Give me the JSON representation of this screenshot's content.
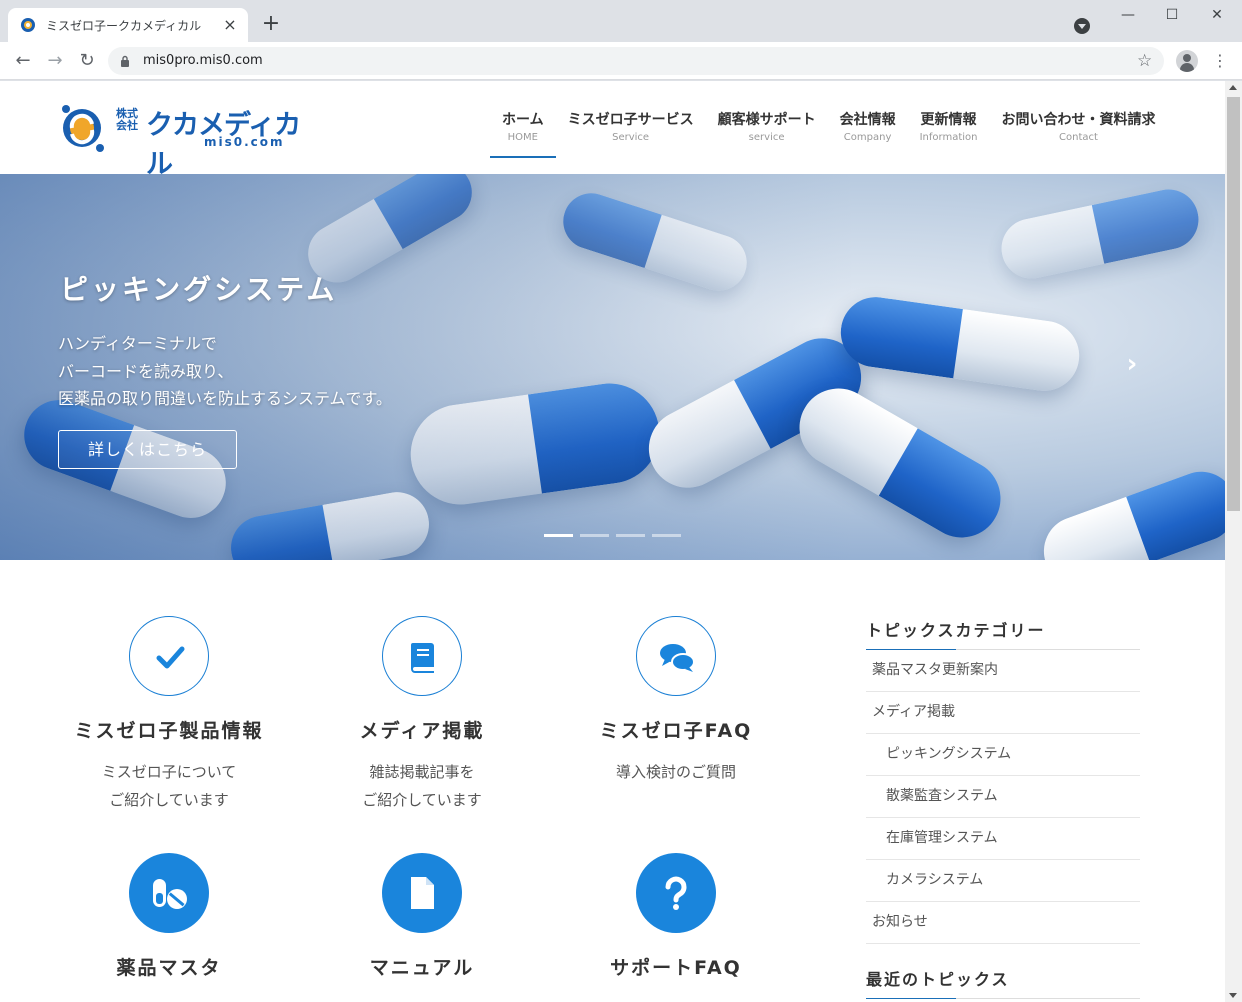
{
  "browser": {
    "tab_title": "ミスゼロ子ークカメディカル",
    "url": "mis0pro.mis0.com"
  },
  "site": {
    "logo": {
      "kabushiki": "株式会社",
      "name": "クカメディカル",
      "domain": "mis0.com"
    },
    "nav": [
      {
        "jp": "ホーム",
        "en": "HOME"
      },
      {
        "jp": "ミスゼロ子サービス",
        "en": "Service"
      },
      {
        "jp": "顧客様サポート",
        "en": "service"
      },
      {
        "jp": "会社情報",
        "en": "Company"
      },
      {
        "jp": "更新情報",
        "en": "Information"
      },
      {
        "jp": "お問い合わせ・資料請求",
        "en": "Contact"
      }
    ],
    "active_nav": "ホーム"
  },
  "hero": {
    "title": "ピッキングシステム",
    "lines": [
      "ハンディターミナルで",
      "バーコードを読み取り、",
      "医薬品の取り間違いを防止するシステムです。"
    ],
    "button": "詳しくはこちら",
    "slide_count": 4,
    "current_slide": 1
  },
  "features": [
    {
      "title": "ミスゼロ子製品情報",
      "desc": [
        "ミスゼロ子について",
        "ご紹介しています"
      ],
      "icon": "check-icon",
      "style": "outline"
    },
    {
      "title": "メディア掲載",
      "desc": [
        "雑誌掲載記事を",
        "ご紹介しています"
      ],
      "icon": "book-icon",
      "style": "outline"
    },
    {
      "title": "ミスゼロ子FAQ",
      "desc": [
        "導入検討のご質問"
      ],
      "icon": "chat-bubbles-icon",
      "style": "outline"
    },
    {
      "title": "薬品マスタ",
      "desc": [],
      "icon": "pills-icon",
      "style": "filled"
    },
    {
      "title": "マニュアル",
      "desc": [],
      "icon": "document-icon",
      "style": "filled"
    },
    {
      "title": "サポートFAQ",
      "desc": [],
      "icon": "question-icon",
      "style": "filled"
    }
  ],
  "sidebar": {
    "categories_heading": "トピックスカテゴリー",
    "categories": [
      {
        "label": "薬品マスタ更新案内",
        "sub": false
      },
      {
        "label": "メディア掲載",
        "sub": false
      },
      {
        "label": "ピッキングシステム",
        "sub": true
      },
      {
        "label": "散薬監査システム",
        "sub": true
      },
      {
        "label": "在庫管理システム",
        "sub": true
      },
      {
        "label": "カメラシステム",
        "sub": true
      },
      {
        "label": "お知らせ",
        "sub": false
      }
    ],
    "recent_heading": "最近のトピックス"
  },
  "colors": {
    "accent": "#1a85dc",
    "brand": "#1a5fb0",
    "text": "#333333"
  }
}
